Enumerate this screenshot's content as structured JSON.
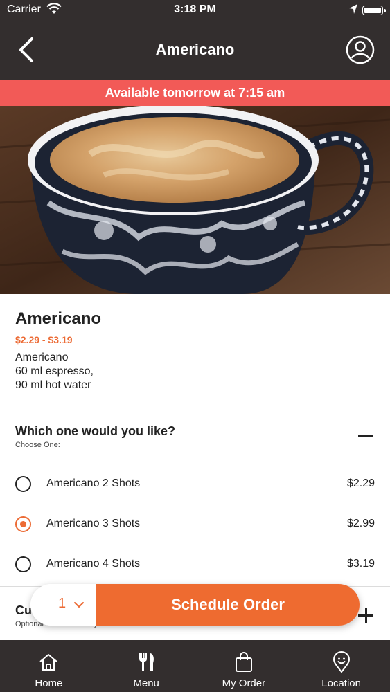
{
  "statusbar": {
    "carrier": "Carrier",
    "time": "3:18 PM"
  },
  "navbar": {
    "title": "Americano"
  },
  "banner": {
    "text": "Available tomorrow at 7:15 am"
  },
  "product": {
    "name": "Americano",
    "price_range": "$2.29 - $3.19",
    "desc_lines": [
      "Americano",
      "60 ml espresso,",
      "90 ml hot water"
    ]
  },
  "question_group": {
    "title": "Which one would you like?",
    "subtitle": "Choose One:",
    "options": [
      {
        "label": "Americano 2 Shots",
        "price": "$2.29",
        "selected": false
      },
      {
        "label": "Americano 3 Shots",
        "price": "$2.99",
        "selected": true
      },
      {
        "label": "Americano 4 Shots",
        "price": "$3.19",
        "selected": false
      }
    ]
  },
  "cup_group": {
    "title": "Cu",
    "subtitle": "Optional · Choose Many:"
  },
  "order": {
    "quantity": "1",
    "button_label": "Schedule Order"
  },
  "tabbar": {
    "tabs": [
      {
        "label": "Home",
        "icon": "home-icon"
      },
      {
        "label": "Menu",
        "icon": "fork-knife-icon"
      },
      {
        "label": "My Order",
        "icon": "shopping-bag-icon"
      },
      {
        "label": "Location",
        "icon": "location-pin-icon"
      }
    ]
  },
  "colors": {
    "dark_bar": "#332e2e",
    "banner_red": "#f25a57",
    "accent_orange": "#ec6b35"
  }
}
